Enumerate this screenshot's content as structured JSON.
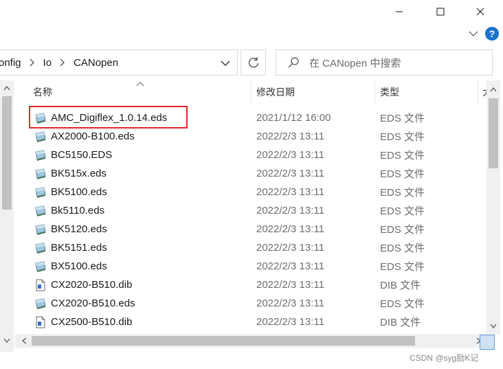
{
  "window": {
    "minimize_label": "—",
    "maximize_label": "□",
    "close_label": "✕"
  },
  "ribbon": {
    "help_label": "?"
  },
  "address": {
    "crumbs": [
      "onfig",
      "Io",
      "CANopen"
    ]
  },
  "search": {
    "placeholder": "在 CANopen 中搜索"
  },
  "columns": {
    "name": "名称",
    "modified": "修改日期",
    "type": "类型",
    "size_partial": "大"
  },
  "files": [
    {
      "name": "AMC_Digiflex_1.0.14.eds",
      "date": "2021/1/12 16:00",
      "type": "EDS 文件",
      "icon": "eds-file-icon",
      "highlighted": true
    },
    {
      "name": "AX2000-B100.eds",
      "date": "2022/2/3 13:11",
      "type": "EDS 文件",
      "icon": "eds-file-icon"
    },
    {
      "name": "BC5150.EDS",
      "date": "2022/2/3 13:11",
      "type": "EDS 文件",
      "icon": "eds-file-icon"
    },
    {
      "name": "BK515x.eds",
      "date": "2022/2/3 13:11",
      "type": "EDS 文件",
      "icon": "eds-file-icon"
    },
    {
      "name": "BK5100.eds",
      "date": "2022/2/3 13:11",
      "type": "EDS 文件",
      "icon": "eds-file-icon"
    },
    {
      "name": "Bk5110.eds",
      "date": "2022/2/3 13:11",
      "type": "EDS 文件",
      "icon": "eds-file-icon"
    },
    {
      "name": "BK5120.eds",
      "date": "2022/2/3 13:11",
      "type": "EDS 文件",
      "icon": "eds-file-icon"
    },
    {
      "name": "BK5151.eds",
      "date": "2022/2/3 13:11",
      "type": "EDS 文件",
      "icon": "eds-file-icon"
    },
    {
      "name": "BX5100.eds",
      "date": "2022/2/3 13:11",
      "type": "EDS 文件",
      "icon": "eds-file-icon"
    },
    {
      "name": "CX2020-B510.dib",
      "date": "2022/2/3 13:11",
      "type": "DIB 文件",
      "icon": "dib-file-icon"
    },
    {
      "name": "CX2020-B510.eds",
      "date": "2022/2/3 13:11",
      "type": "EDS 文件",
      "icon": "eds-file-icon"
    },
    {
      "name": "CX2500-B510.dib",
      "date": "2022/2/3 13:11",
      "type": "DIB 文件",
      "icon": "dib-file-icon"
    }
  ],
  "watermark": "CSDN @syg励K记",
  "colors": {
    "highlight_border": "#e3262a",
    "help_blue": "#1a73c9",
    "scroll_thumb": "#c1c1c1"
  }
}
